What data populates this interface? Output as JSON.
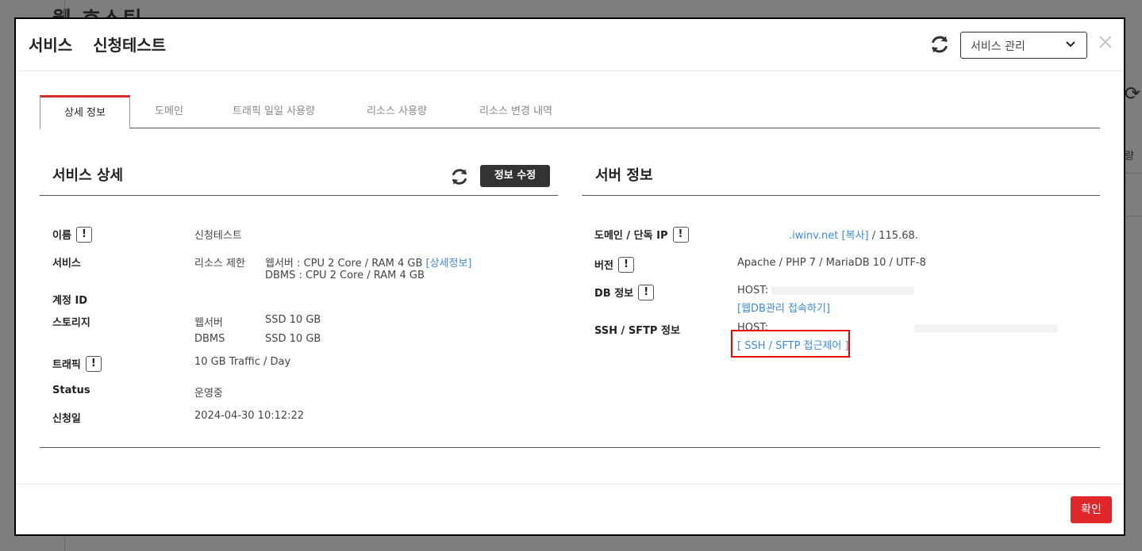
{
  "background": {
    "title": "웹 호스팅",
    "right_text": "량"
  },
  "header": {
    "title": "서비스",
    "service_name": "신청테스트",
    "select_value": "서비스 관리"
  },
  "tabs": [
    {
      "label": "상세 정보"
    },
    {
      "label": "도메인"
    },
    {
      "label": "트래픽 일일 사용량"
    },
    {
      "label": "리소스 사용량"
    },
    {
      "label": "리소스 변경 내역"
    }
  ],
  "service_detail": {
    "title": "서비스 상세",
    "edit_label": "정보 수정",
    "name_label": "이름",
    "name_value": "신청테스트",
    "service_label": "서비스",
    "service_sub": "리소스 제한",
    "web_resource": "웹서버 : CPU 2 Core / RAM 4 GB",
    "detail_link": "[상세정보]",
    "dbms_resource": "DBMS : CPU 2 Core / RAM 4 GB",
    "account_label": "계정 ID",
    "storage_label": "스토리지",
    "storage_web_label": "웹서버",
    "storage_web_value": "SSD 10 GB",
    "storage_db_label": "DBMS",
    "storage_db_value": "SSD 10 GB",
    "traffic_label": "트래픽",
    "traffic_value": "10 GB Traffic / Day",
    "status_label": "Status",
    "status_value": "운영중",
    "date_label": "신청일",
    "date_value": "2024-04-30 10:12:22"
  },
  "server_info": {
    "title": "서버 정보",
    "domain_label": "도메인 / 단독 IP",
    "domain_value": ".iwinv.net",
    "copy_link": "[복사]",
    "ip_value": "/ 115.68.",
    "version_label": "버전",
    "version_value": "Apache / PHP 7 / MariaDB 10 / UTF-8",
    "db_label": "DB 정보",
    "db_host": "HOST:",
    "db_link": "[웹DB관리 접속하기]",
    "ssh_label": "SSH / SFTP 정보",
    "ssh_host": "HOST:",
    "ssh_link": "[ SSH / SFTP 접근제어 ]"
  },
  "footer": {
    "ok_label": "확인"
  },
  "colors": {
    "accent": "#e0282c",
    "link": "#3a8bd6",
    "highlight": "#ee0000"
  }
}
